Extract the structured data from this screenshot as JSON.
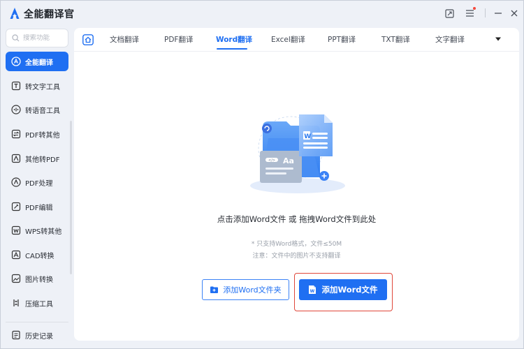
{
  "app": {
    "title": "全能翻译官",
    "accent": "#1f6ff2"
  },
  "titlebar": {
    "buttons": [
      "pin-window-icon",
      "menu-icon",
      "minimize-icon",
      "close-icon"
    ]
  },
  "sidebar": {
    "search_placeholder": "搜索功能",
    "items": [
      {
        "label": "全能翻译",
        "icon": "translate-icon",
        "active": true
      },
      {
        "label": "转文字工具",
        "icon": "text-convert-icon"
      },
      {
        "label": "转语音工具",
        "icon": "voice-icon"
      },
      {
        "label": "PDF转其他",
        "icon": "pdf-convert-icon"
      },
      {
        "label": "其他转PDF",
        "icon": "to-pdf-icon"
      },
      {
        "label": "PDF处理",
        "icon": "pdf-process-icon"
      },
      {
        "label": "PDF编辑",
        "icon": "pdf-edit-icon"
      },
      {
        "label": "WPS转其他",
        "icon": "wps-icon"
      },
      {
        "label": "CAD转换",
        "icon": "cad-icon"
      },
      {
        "label": "图片转换",
        "icon": "image-icon"
      },
      {
        "label": "压缩工具",
        "icon": "compress-icon"
      }
    ],
    "history": {
      "label": "历史记录",
      "icon": "history-icon"
    }
  },
  "tabs": {
    "items": [
      "文档翻译",
      "PDF翻译",
      "Word翻译",
      "Excel翻译",
      "PPT翻译",
      "TXT翻译",
      "文字翻译"
    ],
    "active": "Word翻译"
  },
  "main": {
    "drop_text": "点击添加Word文件 或 拖拽Word文件到此处",
    "note1": "* 只支持Word格式，文件≤50M",
    "note2": "注意：文件中的图片不支持翻译",
    "add_folder_label": "添加Word文件夹",
    "add_file_label": "添加Word文件"
  }
}
